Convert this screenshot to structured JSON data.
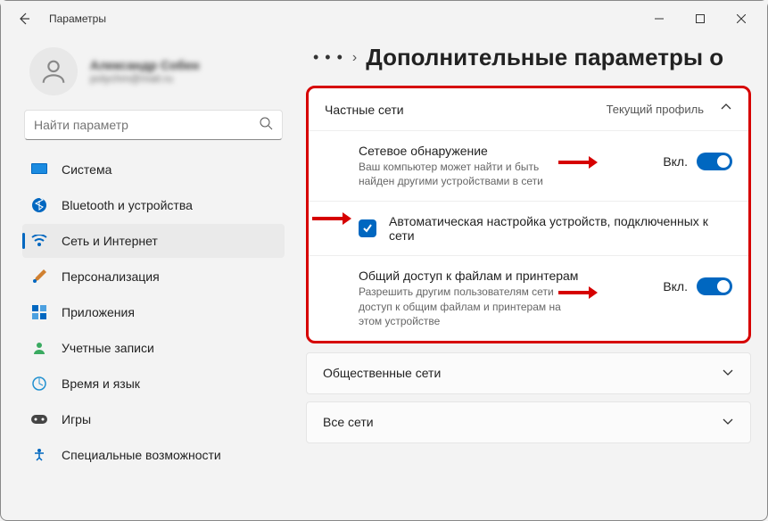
{
  "titlebar": {
    "title": "Параметры"
  },
  "profile": {
    "name": "Александр Собен",
    "email": "polychm@mail.ru"
  },
  "search": {
    "placeholder": "Найти параметр"
  },
  "sidebar": {
    "items": [
      {
        "label": "Система"
      },
      {
        "label": "Bluetooth и устройства"
      },
      {
        "label": "Сеть и Интернет"
      },
      {
        "label": "Персонализация"
      },
      {
        "label": "Приложения"
      },
      {
        "label": "Учетные записи"
      },
      {
        "label": "Время и язык"
      },
      {
        "label": "Игры"
      },
      {
        "label": "Специальные возможности"
      }
    ]
  },
  "header": {
    "dots": "• • •",
    "sep": "›",
    "title": "Дополнительные параметры о"
  },
  "panel": {
    "title": "Частные сети",
    "subtitle": "Текущий профиль",
    "rows": [
      {
        "title": "Сетевое обнаружение",
        "desc": "Ваш компьютер может найти и быть найден другими устройствами в сети",
        "toggle_label": "Вкл."
      },
      {
        "title": "Автоматическая настройка устройств, подключенных к сети"
      },
      {
        "title": "Общий доступ к файлам и принтерам",
        "desc": "Разрешить другим пользователям сети доступ к общим файлам и принтерам на этом устройстве",
        "toggle_label": "Вкл."
      }
    ]
  },
  "collapsed": [
    {
      "label": "Общественные сети"
    },
    {
      "label": "Все сети"
    }
  ]
}
